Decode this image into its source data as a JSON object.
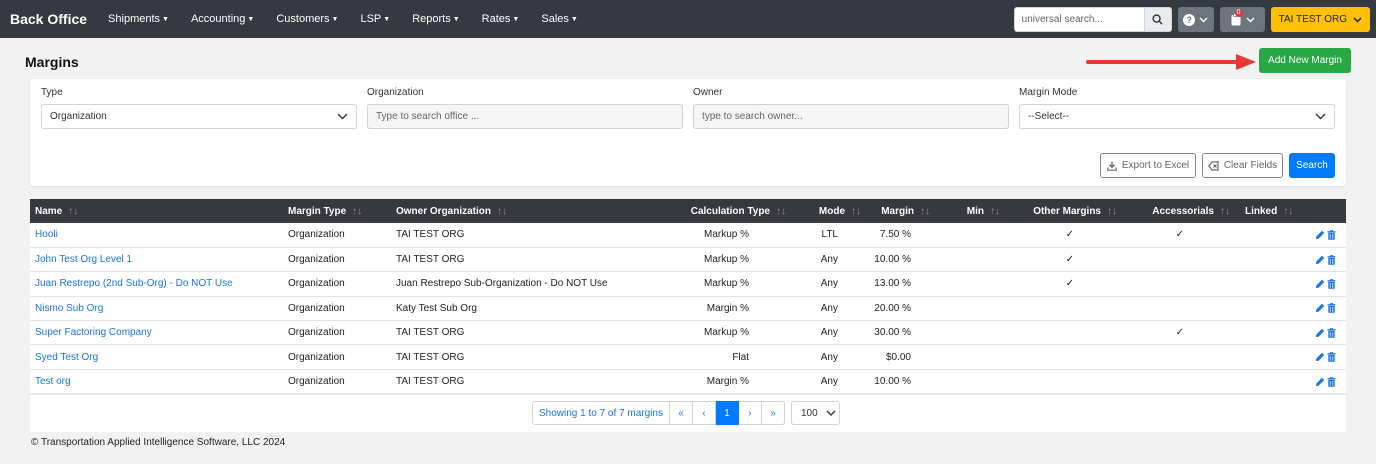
{
  "nav": {
    "brand": "Back Office",
    "items": [
      {
        "label": "Shipments"
      },
      {
        "label": "Accounting"
      },
      {
        "label": "Customers"
      },
      {
        "label": "LSP"
      },
      {
        "label": "Reports"
      },
      {
        "label": "Rates"
      },
      {
        "label": "Sales"
      }
    ],
    "search_placeholder": "universal search...",
    "cart_badge": "0",
    "org_label": "TAI TEST ORG"
  },
  "page": {
    "title": "Margins",
    "add_button": "Add New Margin"
  },
  "filters": {
    "type_label": "Type",
    "type_value": "Organization",
    "org_label": "Organization",
    "org_placeholder": "Type to search office ...",
    "owner_label": "Owner",
    "owner_placeholder": "type to search owner...",
    "mode_label": "Margin Mode",
    "mode_value": "--Select--",
    "export_label": "Export to Excel",
    "clear_label": "Clear Fields",
    "search_label": "Search"
  },
  "table": {
    "headers": {
      "name": "Name",
      "margin_type": "Margin Type",
      "owner_org": "Owner Organization",
      "calc_type": "Calculation Type",
      "mode": "Mode",
      "margin": "Margin",
      "min": "Min",
      "other_margins": "Other Margins",
      "accessorials": "Accessorials",
      "linked": "Linked"
    },
    "rows": [
      {
        "name": "Hooli",
        "margin_type": "Organization",
        "owner": "TAI TEST ORG",
        "calc": "Markup %",
        "mode": "LTL",
        "margin": "7.50 %",
        "min": "",
        "other": "✓",
        "acc": "✓",
        "linked": ""
      },
      {
        "name": "John Test Org Level 1",
        "margin_type": "Organization",
        "owner": "TAI TEST ORG",
        "calc": "Markup %",
        "mode": "Any",
        "margin": "10.00 %",
        "min": "",
        "other": "✓",
        "acc": "",
        "linked": ""
      },
      {
        "name": "Juan Restrepo (2nd Sub-Org) - Do NOT Use",
        "margin_type": "Organization",
        "owner": "Juan Restrepo Sub-Organization - Do NOT Use",
        "calc": "Markup %",
        "mode": "Any",
        "margin": "13.00 %",
        "min": "",
        "other": "✓",
        "acc": "",
        "linked": ""
      },
      {
        "name": "Nismo Sub Org",
        "margin_type": "Organization",
        "owner": "Katy Test Sub Org",
        "calc": "Margin %",
        "mode": "Any",
        "margin": "20.00 %",
        "min": "",
        "other": "",
        "acc": "",
        "linked": ""
      },
      {
        "name": "Super Factoring Company",
        "margin_type": "Organization",
        "owner": "TAI TEST ORG",
        "calc": "Markup %",
        "mode": "Any",
        "margin": "30.00 %",
        "min": "",
        "other": "",
        "acc": "✓",
        "linked": ""
      },
      {
        "name": "Syed Test Org",
        "margin_type": "Organization",
        "owner": "TAI TEST ORG",
        "calc": "Flat",
        "mode": "Any",
        "margin": "$0.00",
        "min": "",
        "other": "",
        "acc": "",
        "linked": ""
      },
      {
        "name": "Test org",
        "margin_type": "Organization",
        "owner": "TAI TEST ORG",
        "calc": "Margin %",
        "mode": "Any",
        "margin": "10.00 %",
        "min": "",
        "other": "",
        "acc": "",
        "linked": ""
      }
    ]
  },
  "pagination": {
    "info": "Showing 1 to 7 of 7 margins",
    "first": "«",
    "prev": "‹",
    "current": "1",
    "next": "›",
    "last": "»",
    "page_size": "100"
  },
  "footer": "© Transportation Applied Intelligence Software, LLC 2024",
  "colors": {
    "nav_bg": "#343a40",
    "add_button": "#28a745",
    "search_button": "#007bff",
    "org_button": "#ffc107",
    "link": "#1a73e8",
    "arrow": "#e53935"
  }
}
